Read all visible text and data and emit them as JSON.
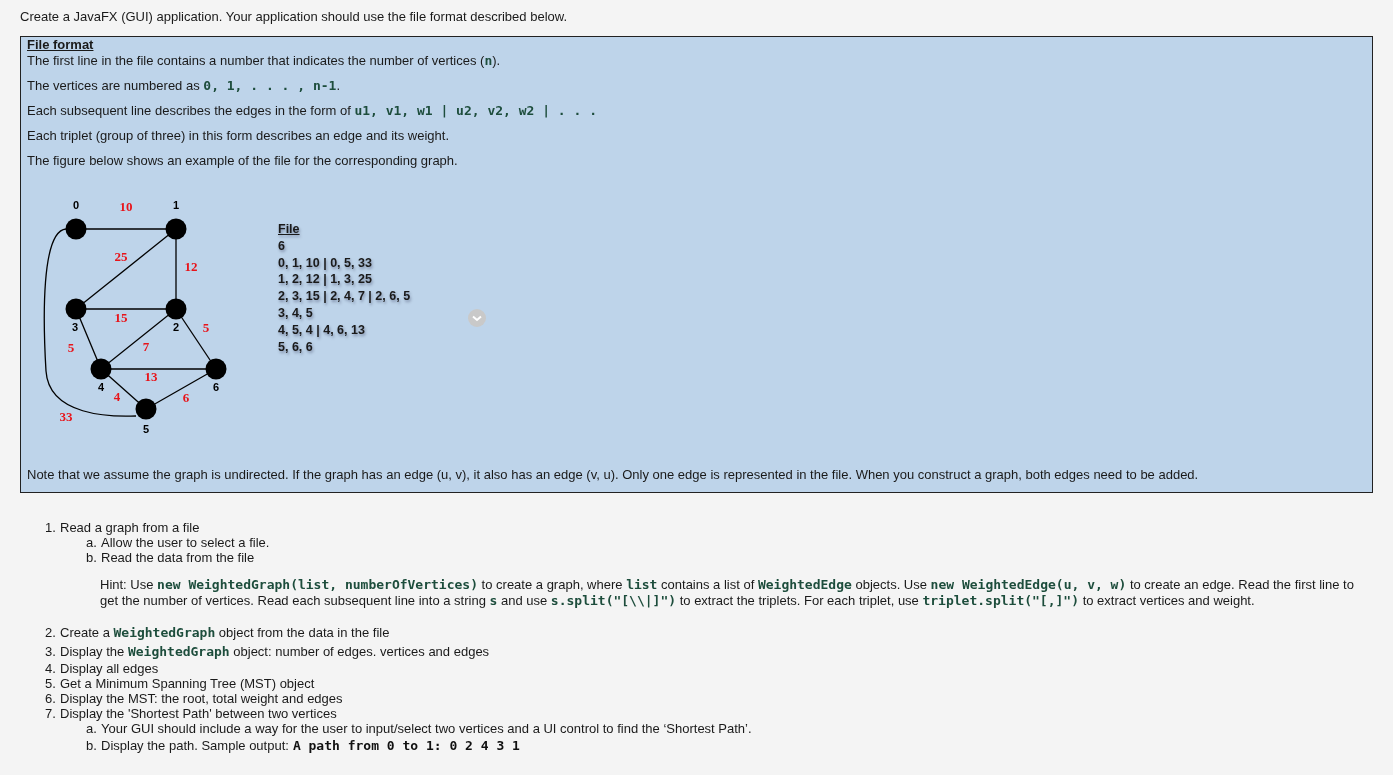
{
  "intro": "Create a JavaFX (GUI) application. Your application should use the file format described below.",
  "format_box": {
    "heading": "File format",
    "paragraphs": [
      "The first line in the file contains a number that indicates the number of vertices (**n**).",
      "The vertices are numbered as **0, 1, . . . , n-1**.",
      "Each subsequent line describes the edges in the form of **u1, v1, w1 | u2, v2, w2 | . . .**",
      "Each triplet (group of three) in this form describes an edge and its weight.",
      "The figure below shows an example of the file for the corresponding graph."
    ],
    "graph": {
      "nodes": [
        {
          "label": "0"
        },
        {
          "label": "1"
        },
        {
          "label": "2"
        },
        {
          "label": "3"
        },
        {
          "label": "4"
        },
        {
          "label": "5"
        },
        {
          "label": "6"
        }
      ],
      "edges": [
        {
          "weight": "10"
        },
        {
          "weight": "33"
        },
        {
          "weight": "12"
        },
        {
          "weight": "25"
        },
        {
          "weight": "15"
        },
        {
          "weight": "7"
        },
        {
          "weight": "5"
        },
        {
          "weight": "5"
        },
        {
          "weight": "4"
        },
        {
          "weight": "13"
        },
        {
          "weight": "6"
        }
      ]
    },
    "file_listing": {
      "title": "File",
      "lines": [
        "6",
        "0, 1, 10 | 0, 5, 33",
        "1, 2, 12 | 1, 3, 25",
        "2, 3, 15 | 2, 4, 7 | 2, 6, 5",
        "3, 4, 5",
        "4, 5, 4 | 4, 6, 13",
        "5, 6, 6"
      ]
    },
    "note": "Note that we assume the graph is undirected. If the graph has an edge (u, v), it also has an edge (v, u). Only one edge is represented in the file. When you construct a graph, both edges need to be added."
  },
  "tasks": [
    {
      "number": "1.",
      "text": "Read a graph from a file",
      "children": [
        {
          "number": "a.",
          "text": "Allow the user to select a file."
        },
        {
          "number": "b.",
          "text": "Read the data from the file"
        }
      ],
      "hint": "Hint: Use **new WeightedGraph(list, numberOfVertices)** to create a graph, where **list** contains a list of **WeightedEdge** objects. Use **new WeightedEdge(u, v, w)** to create an edge. Read the first line to get the number of vertices. Read each subsequent line into a string **s** and use **s.split(\"[\\\\|]\")** to extract the triplets. For each triplet, use **triplet.split(\"[,]\")** to extract vertices and weight."
    },
    {
      "number": "2.",
      "text": "Create a **WeightedGraph** object from the data in the file"
    },
    {
      "number": "3.",
      "text": "Display the **WeightedGraph** object: number of edges. vertices and edges"
    },
    {
      "number": "4.",
      "text": "Display all edges"
    },
    {
      "number": "5.",
      "text": "Get a Minimum Spanning Tree (MST) object"
    },
    {
      "number": "6.",
      "text": "Display the MST: the root, total weight and edges"
    },
    {
      "number": "7.",
      "text": "Display the 'Shortest Path' between two vertices",
      "children": [
        {
          "number": "a.",
          "text": "Your GUI should include a way for the user to input/select two vertices and a UI control to find the ‘Shortest Path’."
        },
        {
          "number": "b.",
          "text": "Display the path. Sample output:",
          "sample": "A path from 0 to 1: 0 2 4 3 1"
        }
      ]
    }
  ]
}
